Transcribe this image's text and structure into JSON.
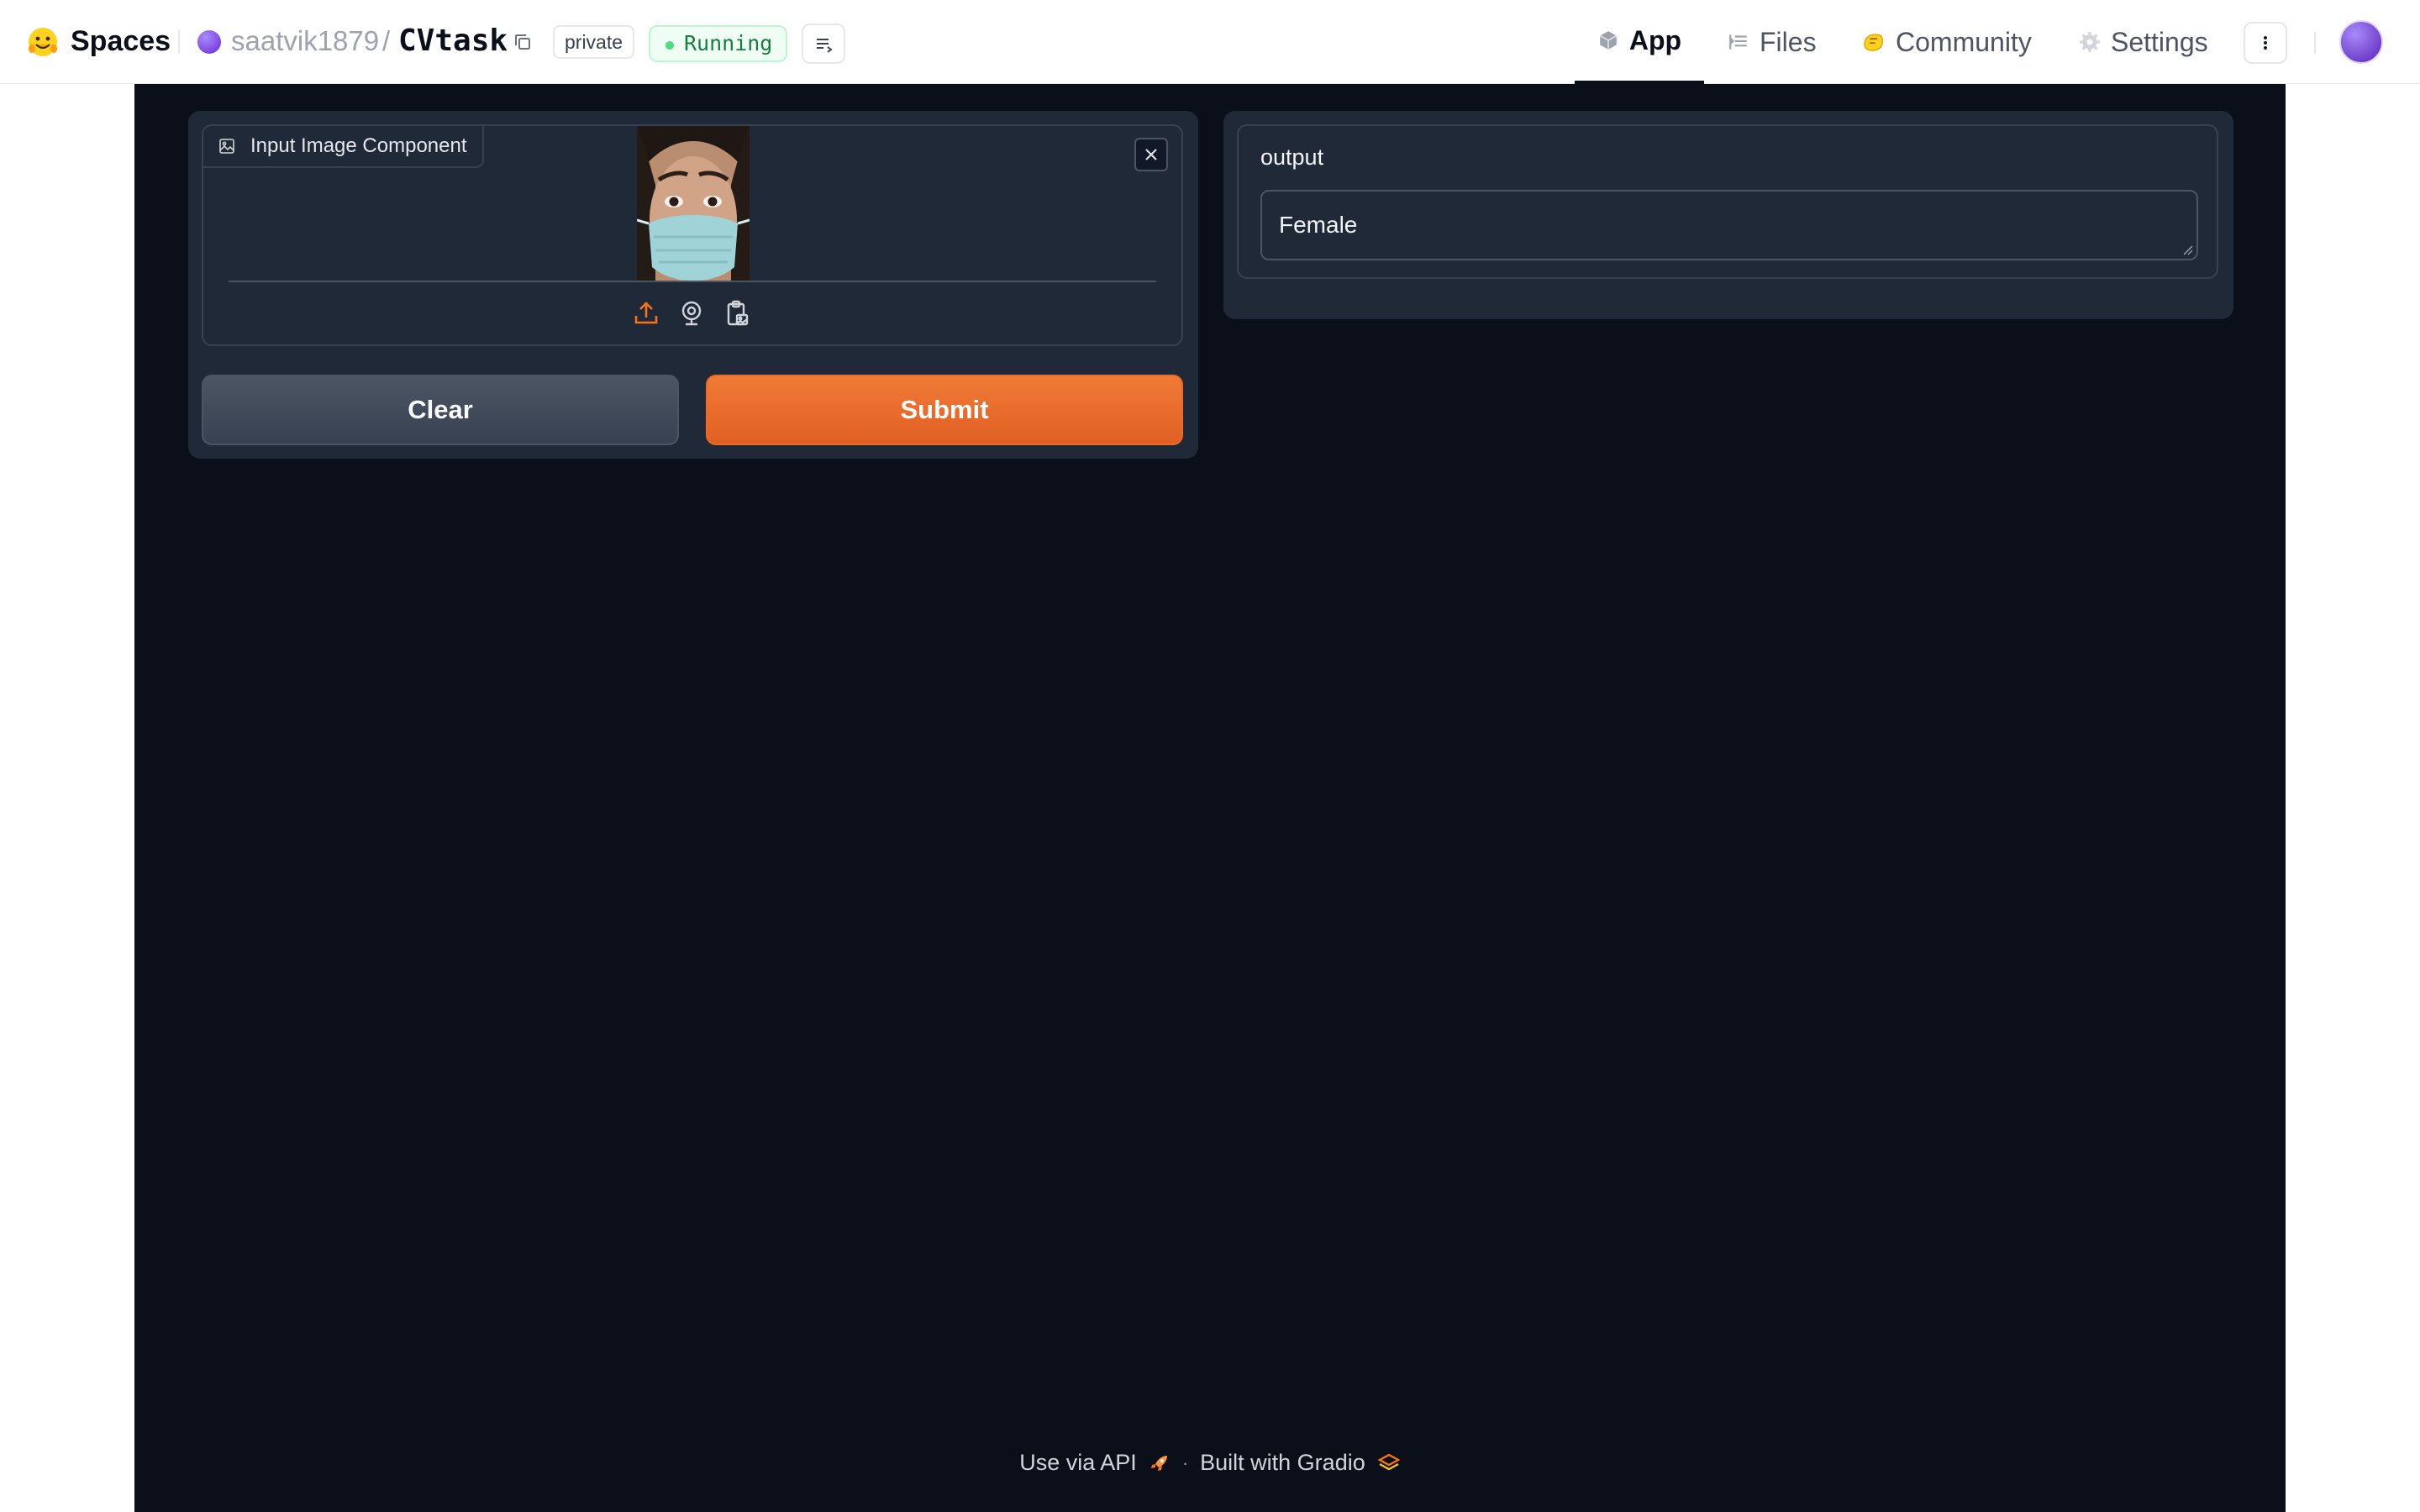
{
  "header": {
    "brand_label": "Spaces",
    "owner": "saatvik1879",
    "separator": "/",
    "repo": "CVtask",
    "visibility_badge": "private",
    "status_badge": "Running",
    "tabs": [
      {
        "label": "App",
        "icon": "cube-icon",
        "active": true
      },
      {
        "label": "Files",
        "icon": "files-icon",
        "active": false
      },
      {
        "label": "Community",
        "icon": "community-icon",
        "active": false
      },
      {
        "label": "Settings",
        "icon": "gear-icon",
        "active": false
      }
    ]
  },
  "input_image": {
    "label": "Input Image Component",
    "sources": [
      "upload-icon",
      "webcam-icon",
      "clipboard-icon"
    ]
  },
  "buttons": {
    "clear_label": "Clear",
    "submit_label": "Submit"
  },
  "output": {
    "label": "output",
    "value": "Female"
  },
  "footer": {
    "api_link": "Use via API",
    "separator": "·",
    "built_with": "Built with Gradio"
  },
  "colors": {
    "app_background": "#0b0f19",
    "panel": "#1f2937",
    "accent": "#ea6a2a",
    "running": "#15803d"
  }
}
